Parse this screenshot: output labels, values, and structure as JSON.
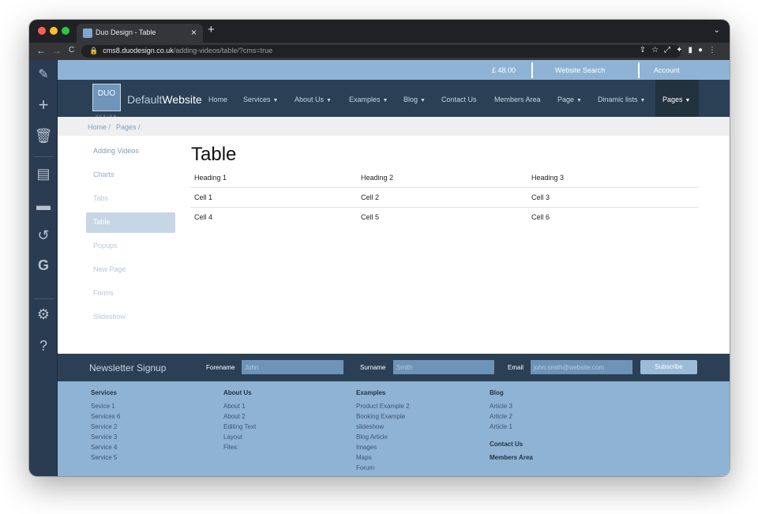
{
  "browser": {
    "tab_title": "Duo Design - Table",
    "tab_close": "×",
    "new_tab": "+",
    "url_host": "cms8.duodesign.co.uk",
    "url_path": "/adding-videos/table/?cms=true",
    "back": "←",
    "forward": "→",
    "reload": "C",
    "dots": [
      "#ff5f57",
      "#febc2e",
      "#28c840"
    ]
  },
  "topbar": {
    "price": "£ 48.00",
    "search": "Website Search",
    "account": "Account"
  },
  "header": {
    "logo_text": "DUO",
    "logo_sub": "DESIGN",
    "brand_a": "Default",
    "brand_b": "Website",
    "menu": [
      {
        "label": "Home",
        "caret": false
      },
      {
        "label": "Services",
        "caret": true
      },
      {
        "label": "About Us",
        "caret": true
      },
      {
        "label": "Examples",
        "caret": true
      },
      {
        "label": "Blog",
        "caret": true
      },
      {
        "label": "Contact Us",
        "caret": false
      },
      {
        "label": "Members Area",
        "caret": false
      },
      {
        "label": "Page",
        "caret": true
      },
      {
        "label": "Dinamic lists",
        "caret": true
      },
      {
        "label": "Pages",
        "caret": true
      }
    ]
  },
  "breadcrumb": {
    "home": "Home /",
    "pages": "Pages /"
  },
  "sidenav": [
    "Adding Videos",
    "Charts",
    "Tabs",
    "Table",
    "Popups",
    "New Page",
    "Forms",
    "Slideshow"
  ],
  "content": {
    "title": "Table",
    "table": {
      "headers": [
        "Heading 1",
        "Heading 2",
        "Heading 3"
      ],
      "rows": [
        [
          "Cell 1",
          "Cell 2",
          "Cell 3"
        ],
        [
          "Cell 4",
          "Cell 5",
          "Cell 6"
        ]
      ]
    }
  },
  "newsletter": {
    "title": "Newsletter Signup",
    "forename_label": "Forename",
    "forename_ph": "John",
    "surname_label": "Surname",
    "surname_ph": "Smith",
    "email_label": "Email",
    "email_ph": "john.smith@website.com",
    "subscribe": "Subscribe"
  },
  "footer": {
    "services": {
      "title": "Services",
      "links": [
        "Sevice 1",
        "Services 6",
        "Service 2",
        "Service 3",
        "Service 4",
        "Service 5"
      ]
    },
    "about": {
      "title": "About Us",
      "links": [
        "About 1",
        "About 2",
        "Editing Text",
        "Layout",
        "Files:"
      ]
    },
    "examples": {
      "title": "Examples",
      "links": [
        "Product Example 2",
        "Booking Example",
        "slideshow",
        "Blog Article",
        "Images",
        "Maps",
        "Forum"
      ]
    },
    "blog": {
      "title": "Blog",
      "links": [
        "Article 3",
        "Article 2",
        "Article 1"
      ]
    },
    "contact": "Contact Us",
    "members": "Members Area"
  },
  "colors": {
    "accent": "#8fb3d4",
    "header": "#2b4055",
    "cms_sidebar": "#2a3c52"
  },
  "icons": [
    "pencil-icon",
    "plus-icon",
    "trash-icon",
    "document-icon",
    "folder-icon",
    "history-icon",
    "google-icon",
    "gear-icon",
    "help-icon",
    "lock-icon",
    "share-icon",
    "star-icon",
    "extensions-icon",
    "sidebar-icon",
    "profile-icon",
    "kebab-menu-icon"
  ]
}
